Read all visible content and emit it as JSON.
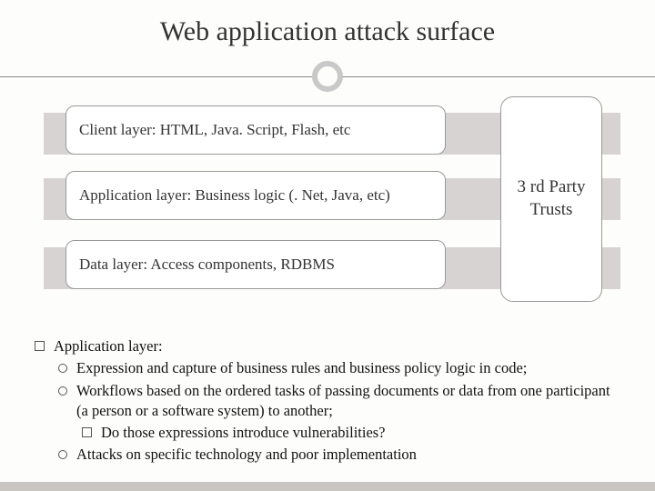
{
  "title": "Web application attack surface",
  "layers": {
    "client": "Client layer: HTML, Java. Script, Flash, etc",
    "application": "Application layer: Business logic (. Net, Java, etc)",
    "data": "Data layer: Access components, RDBMS"
  },
  "trust_box": "3 rd Party Trusts",
  "bullets": {
    "heading": "Application layer:",
    "sub1": "Expression and capture of business rules and business policy logic in code;",
    "sub2": "Workflows based on the ordered tasks of passing documents or data from one participant (a person or a software system) to another;",
    "sub2a": "Do those expressions introduce vulnerabilities?",
    "sub3": "Attacks on specific technology and poor implementation"
  }
}
